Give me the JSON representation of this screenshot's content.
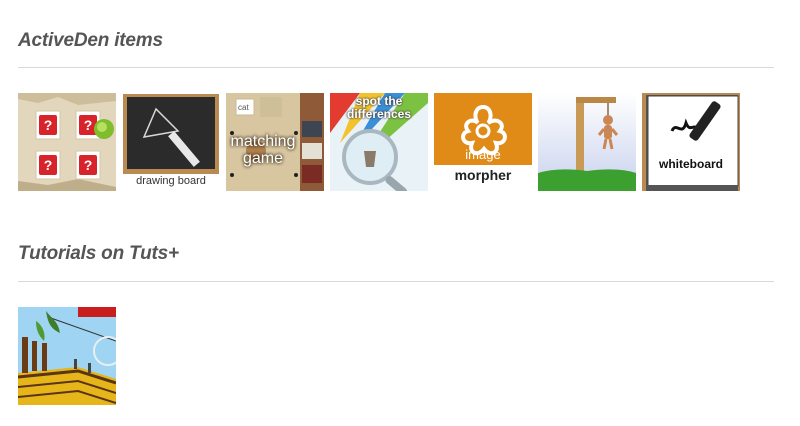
{
  "sections": [
    {
      "title": "ActiveDen items",
      "items": [
        {
          "name": "memory-game"
        },
        {
          "name": "drawing-board",
          "caption": "drawing board"
        },
        {
          "name": "matching-game",
          "caption_line1": "matching",
          "caption_line2": "game",
          "card_text": "cat"
        },
        {
          "name": "spot-the-differences",
          "caption_line1": "spot the",
          "caption_line2": "differences"
        },
        {
          "name": "image-morpher",
          "caption_line1": "image",
          "caption_line2": "morpher"
        },
        {
          "name": "hangman"
        },
        {
          "name": "whiteboard",
          "caption": "whiteboard"
        }
      ]
    },
    {
      "title": "Tutorials on Tuts+",
      "items": [
        {
          "name": "pirate-ship-tutorial"
        }
      ]
    }
  ],
  "colors": {
    "title": "#555555",
    "rule": "#d9d9d9",
    "morpher_orange": "#e08a17",
    "chalkboard": "#2b2b2b",
    "grass": "#3ca030"
  }
}
